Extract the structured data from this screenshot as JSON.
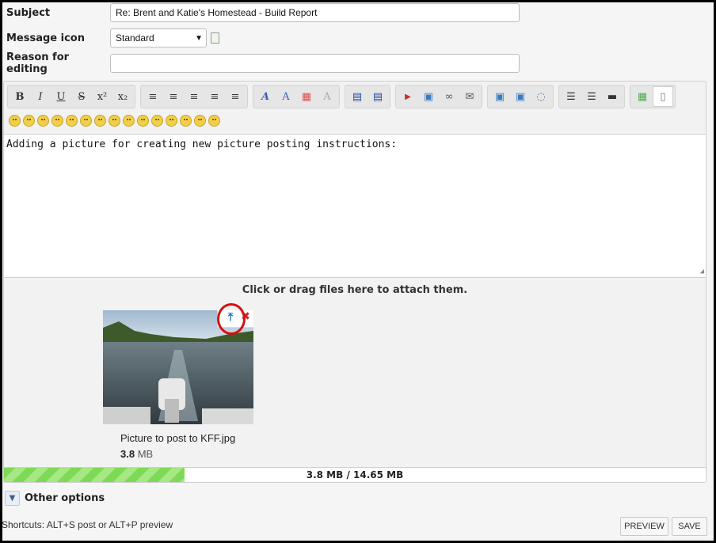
{
  "form": {
    "subject_label": "Subject",
    "subject_value": "Re: Brent and Katie's Homestead - Build Report",
    "icon_label": "Message icon",
    "icon_value": "Standard",
    "reason_label": "Reason for editing",
    "reason_value": ""
  },
  "toolbar": {
    "groups": [
      [
        "bold-icon",
        "italic-icon",
        "underline-icon",
        "strike-icon",
        "superscript-icon",
        "subscript-icon"
      ],
      [
        "align-left-icon",
        "align-center-icon",
        "align-center2-icon",
        "align-right-icon",
        "justify-icon"
      ],
      [
        "font-icon",
        "font-size-icon",
        "color-icon",
        "remove-format-icon"
      ],
      [
        "indent-icon",
        "outdent-icon"
      ],
      [
        "youtube-icon",
        "image-icon",
        "link-icon",
        "email-icon"
      ],
      [
        "insert-icon",
        "code-icon",
        "quote-icon"
      ],
      [
        "bullet-list-icon",
        "numbered-list-icon",
        "rule-icon"
      ],
      [
        "wysiwyg-toggle-icon",
        "source-icon"
      ]
    ],
    "glyphs": {
      "bold": "B",
      "italic": "I",
      "underline": "U",
      "strike": "S",
      "superscript": "x²",
      "subscript": "x₂"
    }
  },
  "smilies_count": 15,
  "editor": {
    "content": "Adding a picture for creating new picture posting instructions:",
    "drop_hint": "Click or drag files here to attach them."
  },
  "attachment": {
    "file_name": "Picture to post to KFF.jpg",
    "size_value": "3.8",
    "size_unit": "MB",
    "insert_glyph": "⤒",
    "delete_glyph": "✖"
  },
  "upload": {
    "progress_fraction": 0.257,
    "progress_text": "3.8 MB / 14.65 MB"
  },
  "other_options_label": "Other options",
  "shortcuts_text": "Shortcuts: ALT+S post or ALT+P preview",
  "buttons": {
    "preview": "PREVIEW",
    "save": "SAVE"
  },
  "colors": {
    "highlight": "#d90f0f",
    "progress": "#7ed957"
  }
}
